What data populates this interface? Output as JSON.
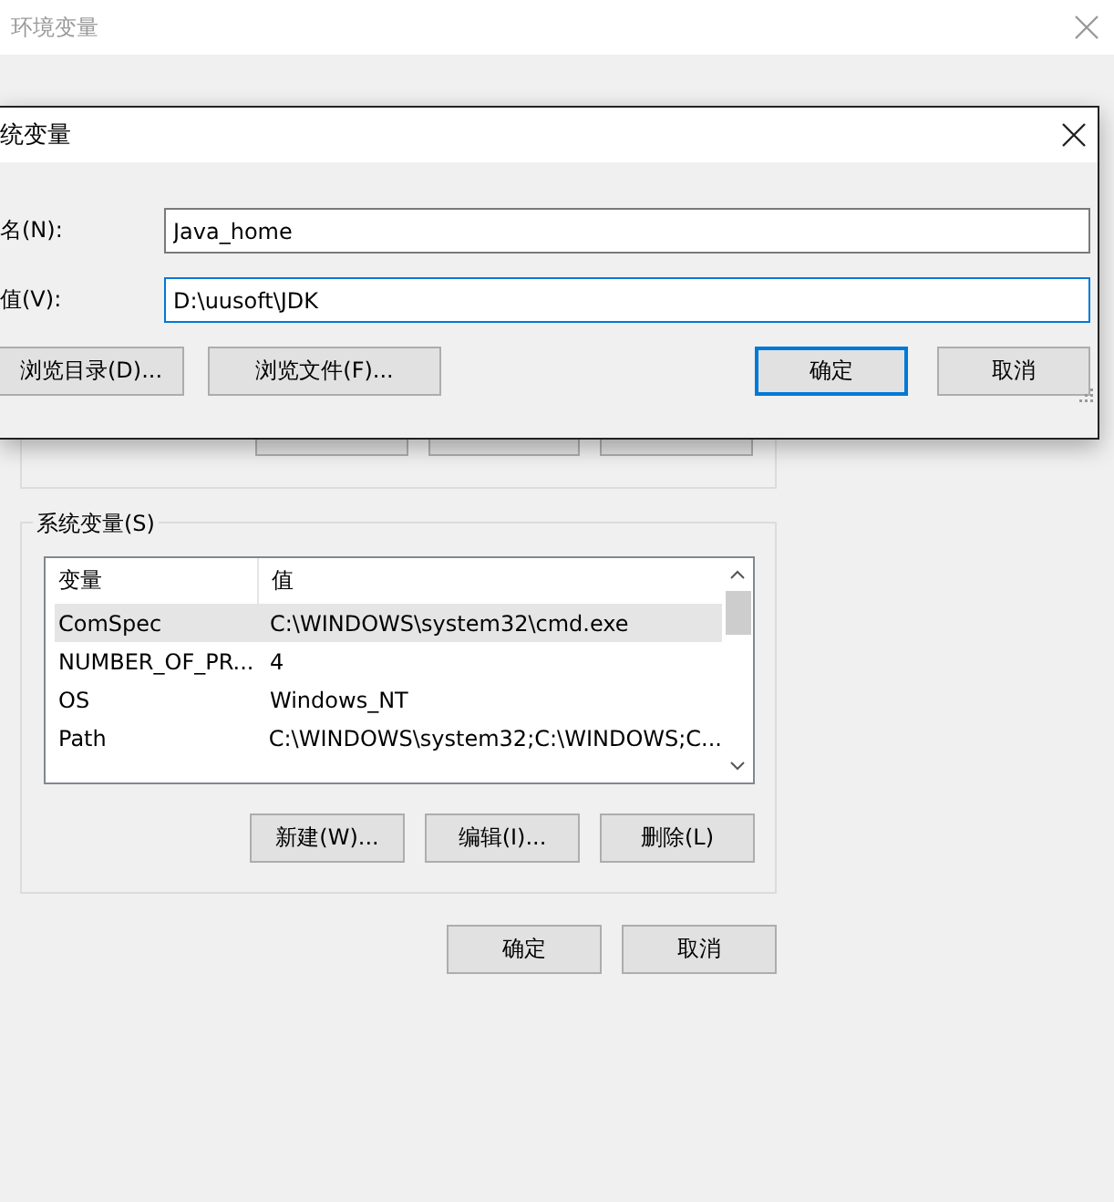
{
  "window": {
    "title": "环境变量"
  },
  "user_variables": {
    "buttons": [
      {
        "kind": "hidden-label"
      },
      {
        "kind": "hidden-label"
      },
      {
        "kind": "hidden-label"
      }
    ]
  },
  "system_variables": {
    "title": "系统变量(S)",
    "columns": [
      "变量",
      "值"
    ],
    "rows": [
      {
        "name": "ComSpec",
        "value": "C:\\WINDOWS\\system32\\cmd.exe",
        "selected": true
      },
      {
        "name": "NUMBER_OF_PR...",
        "value": "4",
        "selected": false
      },
      {
        "name": "OS",
        "value": "Windows_NT",
        "selected": false
      },
      {
        "name": "Path",
        "value": "C:\\WINDOWS\\system32;C:\\WINDOWS;C...",
        "selected": false
      }
    ],
    "buttons": [
      "新建(W)...",
      "编辑(I)...",
      "删除(L)"
    ]
  },
  "buttons": [
    {
      "label": "确定",
      "default": false
    },
    {
      "label": "取消",
      "default": false
    }
  ],
  "dialog": {
    "title": "统变量",
    "fields": [
      {
        "label": "名(N):",
        "value": "Java_home",
        "focused": false
      },
      {
        "label": "值(V):",
        "value": "D:\\uusoft\\JDK",
        "focused": true
      }
    ],
    "left_buttons": [
      "浏览目录(D)...",
      "浏览文件(F)..."
    ],
    "buttons": [
      {
        "label": "确定",
        "default": true
      },
      {
        "label": "取消",
        "default": false
      }
    ]
  }
}
